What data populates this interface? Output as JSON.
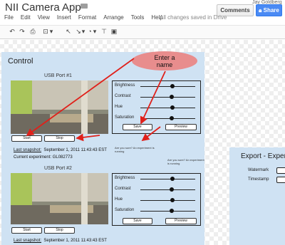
{
  "header": {
    "doc_title": "NII Camera App",
    "user": "Jay Goldberg",
    "comments_label": "Comments",
    "share_label": "Share",
    "save_status": "All changes saved in Drive",
    "star_icon": "star-icon",
    "folder_icon": "folder-icon",
    "lock_icon": "lock-icon"
  },
  "menu": [
    "File",
    "Edit",
    "View",
    "Insert",
    "Format",
    "Arrange",
    "Tools",
    "Help"
  ],
  "toolbar": {
    "undo": "↶",
    "redo": "↷",
    "print": "⎙",
    "zoom": "⊡",
    "zoom_menu": "▾",
    "select": "↖",
    "line": "↘",
    "line_menu": "▾",
    "shape": "◔",
    "shape_menu": "▾",
    "textbox": "⊤",
    "image": "▣"
  },
  "control": {
    "title": "Control",
    "port1": {
      "label": "USB Port #1",
      "start": "Start",
      "stop": "Stop",
      "snapshot_label": "Last snapshot:",
      "snapshot_value": "September 1, 2011 11:43:43 EST",
      "experiment_label": "Current experiment:",
      "experiment_value": "GL082773"
    },
    "port2": {
      "label": "USB Port #2",
      "start": "Start",
      "stop": "Stop",
      "snapshot_label": "Last snapshot:",
      "snapshot_value": "September 1, 2011 11:43:43 EST"
    },
    "settings": [
      "Brightness",
      "Contrast",
      "Hue",
      "Saturation"
    ],
    "settings_values": [
      0.59,
      0.57,
      0.58,
      0.57
    ],
    "save": "Save",
    "preview": "Preview",
    "confirm_note_1": "Are you sure? An experiment is running",
    "confirm_note_2": "Are you sure? An experiment is running"
  },
  "callout": {
    "text_line1": "Enter a",
    "text_line2": "name"
  },
  "export": {
    "title": "Export - Experim",
    "watermark": "Watermark",
    "timestamp": "Timestamp"
  },
  "colors": {
    "panel": "#cfe2f3",
    "callout": "#e88d8d",
    "arrow": "#e0201a",
    "share": "#4a8af4"
  }
}
